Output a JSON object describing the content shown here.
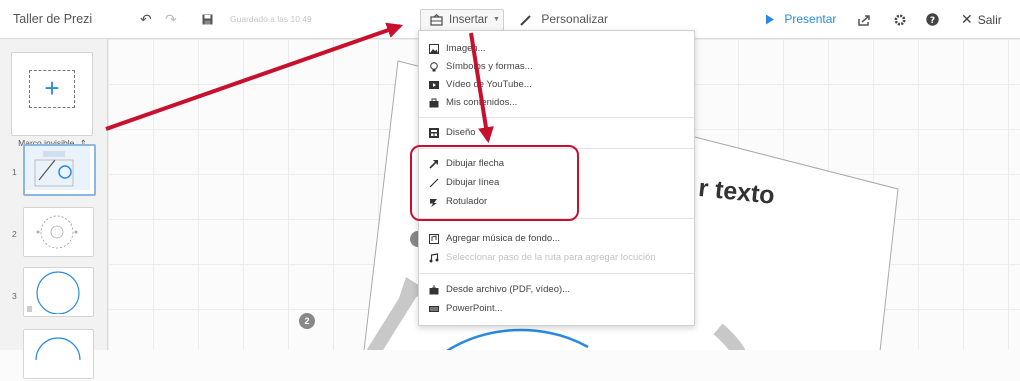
{
  "topbar": {
    "app_title": "Taller de Prezi",
    "saved_text": "Guardado a las 10:49",
    "insert_label": "Insertar",
    "personalize_label": "Personalizar",
    "present_label": "Presentar",
    "exit_label": "Salir"
  },
  "sidebar": {
    "frame_select": "Marco invisible",
    "slides": [
      {
        "number": "1"
      },
      {
        "number": "2"
      },
      {
        "number": "3"
      }
    ]
  },
  "canvas": {
    "visible_text": "r texto",
    "badges": [
      "2"
    ]
  },
  "insert_menu": {
    "groups": [
      [
        "Imagen...",
        "Símbolos y formas...",
        "Vídeo de YouTube...",
        "Mis contenidos..."
      ],
      [
        "Diseño"
      ],
      [
        "Dibujar flecha",
        "Dibujar línea",
        "Rotulador"
      ],
      [
        "Agregar música de fondo...",
        "Seleccionar paso de la ruta para agregar locución"
      ],
      [
        "Desde archivo (PDF, vídeo)...",
        "PowerPoint..."
      ]
    ]
  },
  "colors": {
    "accent": "#2a8ae2",
    "annotation": "#c8102e"
  },
  "icons": [
    "undo-icon",
    "redo-icon",
    "save-icon",
    "insert-icon",
    "pencil-icon",
    "play-icon",
    "share-icon",
    "gear-icon",
    "help-icon",
    "close-icon"
  ]
}
